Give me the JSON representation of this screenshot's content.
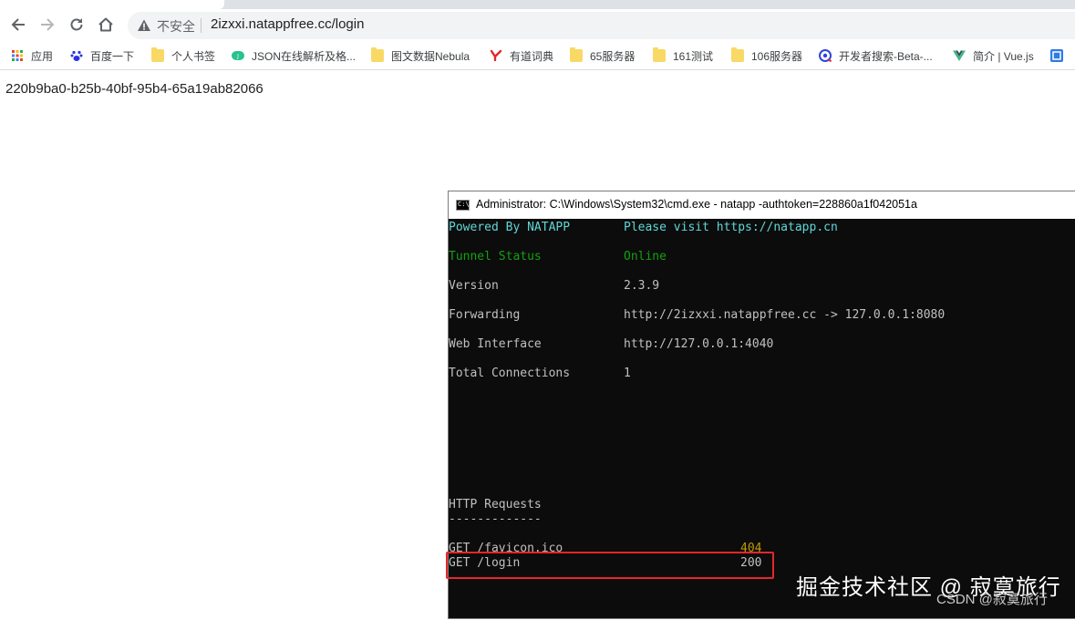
{
  "browser": {
    "insecure_label": "不安全",
    "url": "2izxxi.natappfree.cc/login"
  },
  "bookmarks": [
    {
      "label": "应用",
      "icon": "apps-grid-icon"
    },
    {
      "label": "百度一下",
      "icon": "baidu-paw-icon"
    },
    {
      "label": "个人书签",
      "icon": "folder-icon"
    },
    {
      "label": "JSON在线解析及格...",
      "icon": "json-icon"
    },
    {
      "label": "图文数据Nebula",
      "icon": "folder-icon"
    },
    {
      "label": "有道词典",
      "icon": "youdao-icon"
    },
    {
      "label": "65服务器",
      "icon": "folder-icon"
    },
    {
      "label": "161测试",
      "icon": "folder-icon"
    },
    {
      "label": "106服务器",
      "icon": "folder-icon"
    },
    {
      "label": "开发者搜索-Beta-...",
      "icon": "dev-search-icon"
    },
    {
      "label": "简介 | Vue.js",
      "icon": "vue-icon"
    }
  ],
  "page": {
    "body_text": "220b9ba0-b25b-40bf-95b4-65a19ab82066"
  },
  "cmd": {
    "title": "Administrator: C:\\Windows\\System32\\cmd.exe - natapp  -authtoken=228860a1f042051a",
    "icon_text": "C:\\",
    "rows": {
      "powered_label": "Powered By NATAPP",
      "powered_value": "Please visit https://natapp.cn",
      "tunnel_label": "Tunnel Status",
      "tunnel_value": "Online",
      "version_label": "Version",
      "version_value": "2.3.9",
      "forwarding_label": "Forwarding",
      "forwarding_value": "http://2izxxi.natappfree.cc -> 127.0.0.1:8080",
      "web_label": "Web Interface",
      "web_value": "http://127.0.0.1:4040",
      "conn_label": "Total Connections",
      "conn_value": "1"
    },
    "http_requests_heading": "HTTP Requests",
    "http_requests_rule": "-------------",
    "requests": [
      {
        "path": "GET /favicon.ico",
        "status": "404"
      },
      {
        "path": "GET /login",
        "status": "200"
      }
    ]
  },
  "watermark": {
    "main": "掘金技术社区 @ 寂寞旅行",
    "sub": "CSDN @寂寞旅行"
  },
  "colors": {
    "terminal_bg": "#0c0c0c",
    "terminal_text": "#c0c0c0",
    "cyan": "#61d6d6",
    "green": "#13a10e",
    "amber": "#c19c00",
    "highlight_box": "#e8262a"
  }
}
